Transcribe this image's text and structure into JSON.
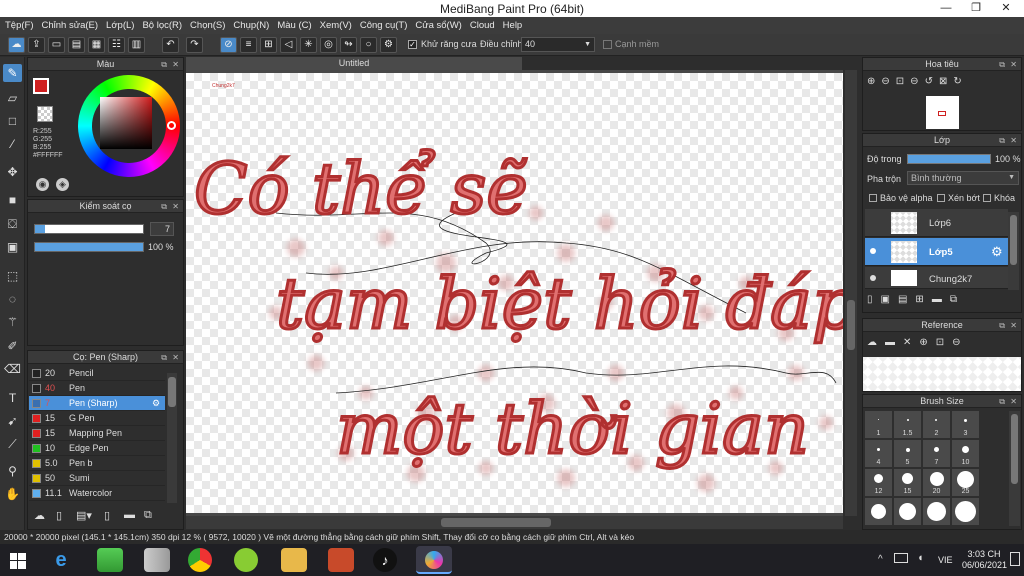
{
  "window": {
    "title": "MediBang Paint Pro (64bit)",
    "min": "—",
    "max": "❐",
    "close": "✕"
  },
  "menu": [
    "Tệp(F)",
    "Chỉnh sửa(E)",
    "Lớp(L)",
    "Bộ lọc(R)",
    "Chọn(S)",
    "Chụp(N)",
    "Màu (C)",
    "Xem(V)",
    "Công cụ(T)",
    "Cửa sổ(W)",
    "Cloud",
    "Help"
  ],
  "toolbar": {
    "antialias_label": "Khử răng cưa",
    "correction_label": "Điều chỉnh",
    "correction_value": "40",
    "edge_label": "Cạnh mềm"
  },
  "color_panel": {
    "title": "Màu",
    "r": "R:255",
    "g": "G:255",
    "b": "B:255",
    "hex": "#FFFFFF",
    "primary": "#d02020",
    "hue": "#d01a1a"
  },
  "brush_control": {
    "title": "Kiểm soát cọ",
    "size": "7",
    "opacity": "100 %",
    "size_fraction": 0.09,
    "opacity_fraction": 1.0
  },
  "brush_list": {
    "title": "Cọ: Pen (Sharp)",
    "items": [
      {
        "num": "20",
        "label": "Pencil",
        "color": "#222222"
      },
      {
        "num": "40",
        "label": "Pen",
        "color": "#222222"
      },
      {
        "num": "7",
        "label": "Pen (Sharp)",
        "color": "#3a6fb0"
      },
      {
        "num": "15",
        "label": "G Pen",
        "color": "#e02020"
      },
      {
        "num": "15",
        "label": "Mapping Pen",
        "color": "#e02020"
      },
      {
        "num": "10",
        "label": "Edge Pen",
        "color": "#20c020"
      },
      {
        "num": "5.0",
        "label": "Pen b",
        "color": "#e0c000"
      },
      {
        "num": "50",
        "label": "Sumi",
        "color": "#e0c000"
      },
      {
        "num": "11.1",
        "label": "Watercolor",
        "color": "#60b0f0"
      }
    ]
  },
  "canvas": {
    "tab_title": "Untitled",
    "small_text": "Chung2k7"
  },
  "navigator": {
    "title": "Hoa tiêu"
  },
  "layers": {
    "title": "Lớp",
    "opacity_label": "Độ trong",
    "opacity_value": "100 %",
    "blend_label": "Pha trộn",
    "blend_value": "Bình thường",
    "protect_alpha": "Bảo vệ alpha",
    "clipping": "Xén bớt",
    "lock": "Khóa",
    "items": [
      {
        "name": "Lớp6"
      },
      {
        "name": "Lớp5"
      },
      {
        "name": "Chung2k7"
      }
    ]
  },
  "reference": {
    "title": "Reference"
  },
  "brush_size": {
    "title": "Brush Size",
    "sizes": [
      "1",
      "1.5",
      "2",
      "3",
      "4",
      "5",
      "7",
      "10",
      "12",
      "15",
      "20",
      "25"
    ]
  },
  "status": {
    "text": "20000 * 20000 pixel  (145.1 * 145.1cm)  350 dpi  12 %  ( 9572, 10020 )  Vẽ một đường thẳng bằng cách giữ phím Shift, Thay đổi cỡ cọ bằng cách giữ phím Ctrl, Alt và kéo"
  },
  "taskbar": {
    "lang": "VIE",
    "time": "3:03 CH",
    "date": "06/06/2021"
  }
}
